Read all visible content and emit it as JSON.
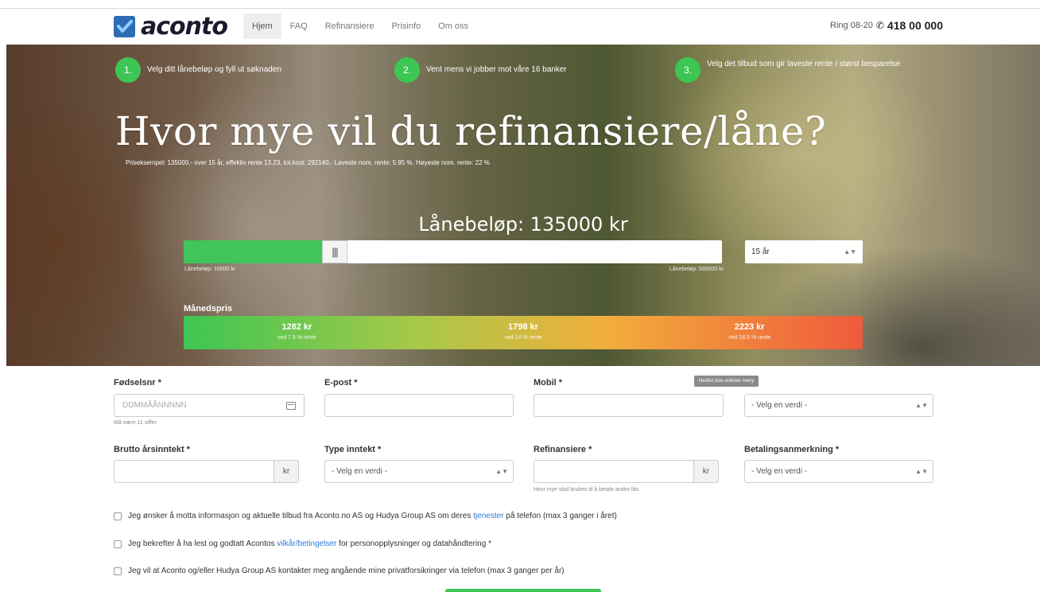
{
  "brand": {
    "name": "aconto",
    "accent": "#3dc653",
    "logo_blue": "#2e6db5"
  },
  "nav": {
    "items": [
      {
        "label": "Hjem",
        "active": true
      },
      {
        "label": "FAQ",
        "active": false
      },
      {
        "label": "Refinansiere",
        "active": false
      },
      {
        "label": "Prisinfo",
        "active": false
      },
      {
        "label": "Om oss",
        "active": false
      }
    ]
  },
  "phone": {
    "prefix": "Ring 08-20",
    "icon": "phone-icon",
    "number": "418 00 000"
  },
  "hero": {
    "steps": [
      {
        "number": "1.",
        "text": "Velg ditt lånebeløp og fyll ut søknaden"
      },
      {
        "number": "2.",
        "text": "Vent mens vi jobber mot våre 16 banker"
      },
      {
        "number": "3.",
        "text": "Velg det tilbud som gir laveste rente / størst besparelse"
      }
    ],
    "headline": "Hvor mye vil du refinansiere/låne?",
    "price_example": "Priseksempel: 135000,- over 15 år, effektiv rente 13.23, tot.kost: 292140,-   Laveste nom. rente: 5.95 %. Høyeste nom. rente: 22 %",
    "loan_label": "Lånebeløp: 135000 kr",
    "slider": {
      "value_fraction": 0.27,
      "min_label": "Lånebeløp: 10000 kr",
      "max_label": "Lånebeløp: 500000 kr"
    },
    "years": {
      "selected": "15 år"
    },
    "monthly": {
      "label": "Månedspris",
      "segments": [
        {
          "amount": "1282 kr",
          "rate": "ved 7.9 % rente"
        },
        {
          "amount": "1798 kr",
          "rate": "ved 14 % rente"
        },
        {
          "amount": "2223 kr",
          "rate": "ved 18.5 % rente"
        }
      ]
    }
  },
  "form": {
    "fodselsnr": {
      "label": "Fødselsnr *",
      "placeholder": "DDMMÅÅNNNNN",
      "help": "Må være 11 siffer",
      "icon": "calendar-icon"
    },
    "epost": {
      "label": "E-post *",
      "value": ""
    },
    "mobil": {
      "label": "Mobil *",
      "value": ""
    },
    "tooltip": "Nedlist liste ordinær meny",
    "extra_select": {
      "selected": "- Velg en verdi -"
    },
    "brutto": {
      "label": "Brutto årsinntekt *",
      "unit": "kr"
    },
    "type_inntekt": {
      "label": "Type inntekt *",
      "selected": "- Velg en verdi -"
    },
    "refinansiere": {
      "label": "Refinansiere *",
      "unit": "kr",
      "help": "Hvor mye skal brukes til å betale andre lån."
    },
    "betalingsanmerkning": {
      "label": "Betalingsanmerkning *",
      "selected": "- Velg en verdi -"
    },
    "consents": [
      {
        "before": "Jeg ønsker å motta informasjon og aktuelle tilbud fra Aconto.no AS og Hudya Group AS om deres ",
        "link": "tjenester",
        "after": " på telefon (max 3 ganger i året)"
      },
      {
        "before": "Jeg bekrefter å ha lest og godtatt Acontos ",
        "link": "vilkår/betingelser",
        "after": " for personopplysninger og datahåndtering *"
      },
      {
        "before": "Jeg vil at Aconto og/eller Hudya Group AS kontakter meg angående mine privatforsikringer via telefon (max 3 ganger per år)",
        "link": "",
        "after": ""
      }
    ]
  }
}
